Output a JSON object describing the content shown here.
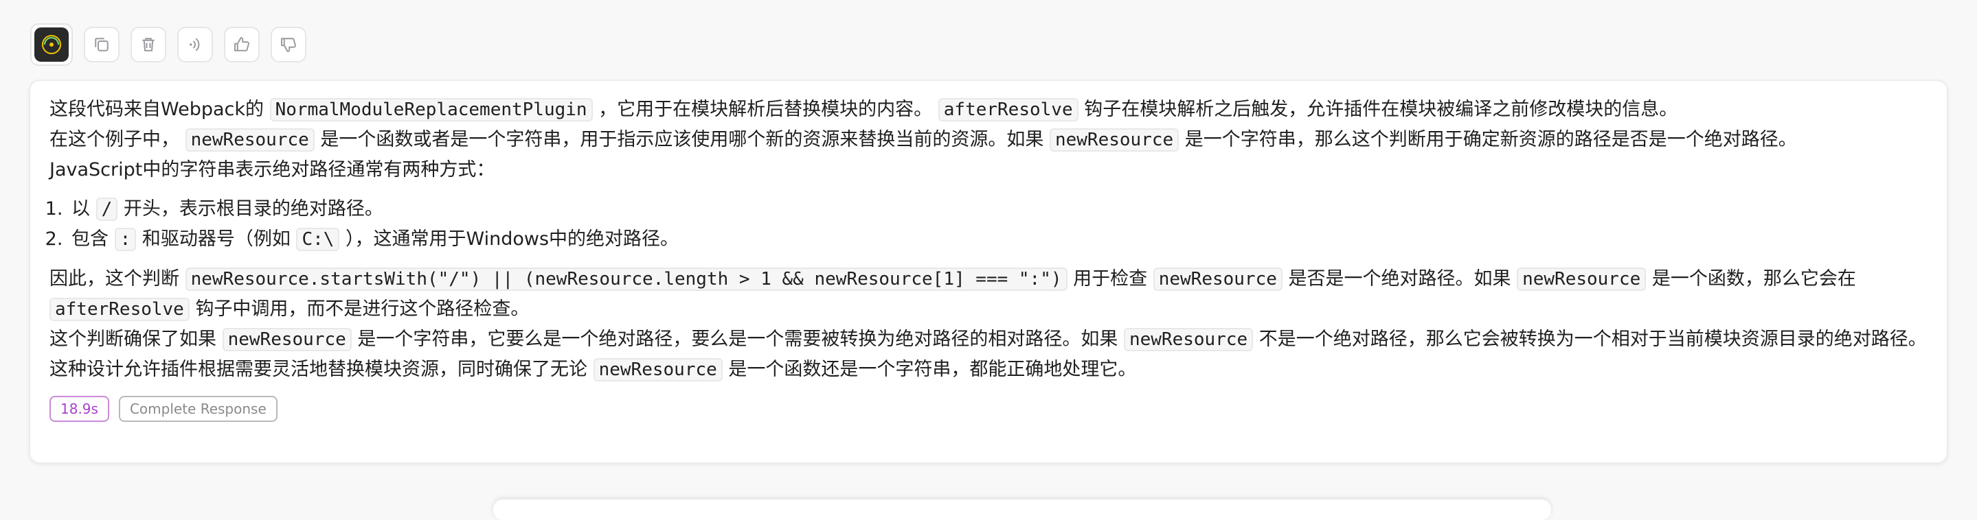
{
  "toolbar": {
    "avatar_icon": "ai-avatar-icon",
    "buttons": [
      {
        "icon": "copy-icon"
      },
      {
        "icon": "trash-icon"
      },
      {
        "icon": "speaker-icon"
      },
      {
        "icon": "thumbs-up-icon"
      },
      {
        "icon": "thumbs-down-icon"
      }
    ]
  },
  "response": {
    "p1": {
      "t1": "这段代码来自Webpack的",
      "c1": "NormalModuleReplacementPlugin",
      "t2": "，它用于在模块解析后替换模块的内容。",
      "c2": "afterResolve",
      "t3": "钩子在模块解析之后触发，允许插件在模块被编译之前修改模块的信息。"
    },
    "p2": {
      "t1": "在这个例子中，",
      "c1": "newResource",
      "t2": "是一个函数或者是一个字符串，用于指示应该使用哪个新的资源来替换当前的资源。如果",
      "c2": "newResource",
      "t3": "是一个字符串，那么这个判断用于确定新资源的路径是否是一个绝对路径。"
    },
    "p3": "JavaScript中的字符串表示绝对路径通常有两种方式：",
    "list": {
      "item1": {
        "t1": "以",
        "c1": "/",
        "t2": "开头，表示根目录的绝对路径。"
      },
      "item2": {
        "t1": "包含",
        "c1": ":",
        "t2": "和驱动器号（例如",
        "c2": "C:\\",
        "t3": "），这通常用于Windows中的绝对路径。"
      }
    },
    "p4": {
      "t1": "因此，这个判断",
      "c1": "newResource.startsWith(\"/\") || (newResource.length > 1 && newResource[1] === \":\")",
      "t2": "用于检查",
      "c2": "newResource",
      "t3": "是否是一个绝对路径。如果",
      "c3": "newResource",
      "t4": "是一个函数，那么它会在",
      "c4": "afterResolve",
      "t5": "钩子中调用，而不是进行这个路径检查。"
    },
    "p5": {
      "t1": "这个判断确保了如果",
      "c1": "newResource",
      "t2": "是一个字符串，它要么是一个绝对路径，要么是一个需要被转换为绝对路径的相对路径。如果",
      "c2": "newResource",
      "t3": "不是一个绝对路径，那么它会被转换为一个相对于当前模块资源目录的绝对路径。"
    },
    "p6": {
      "t1": "这种设计允许插件根据需要灵活地替换模块资源，同时确保了无论",
      "c1": "newResource",
      "t2": "是一个函数还是一个字符串，都能正确地处理它。"
    }
  },
  "badges": {
    "time": "18.9s",
    "status": "Complete Response"
  },
  "colors": {
    "time_badge": "#a742c9",
    "status_badge": "#8a8a8a"
  }
}
